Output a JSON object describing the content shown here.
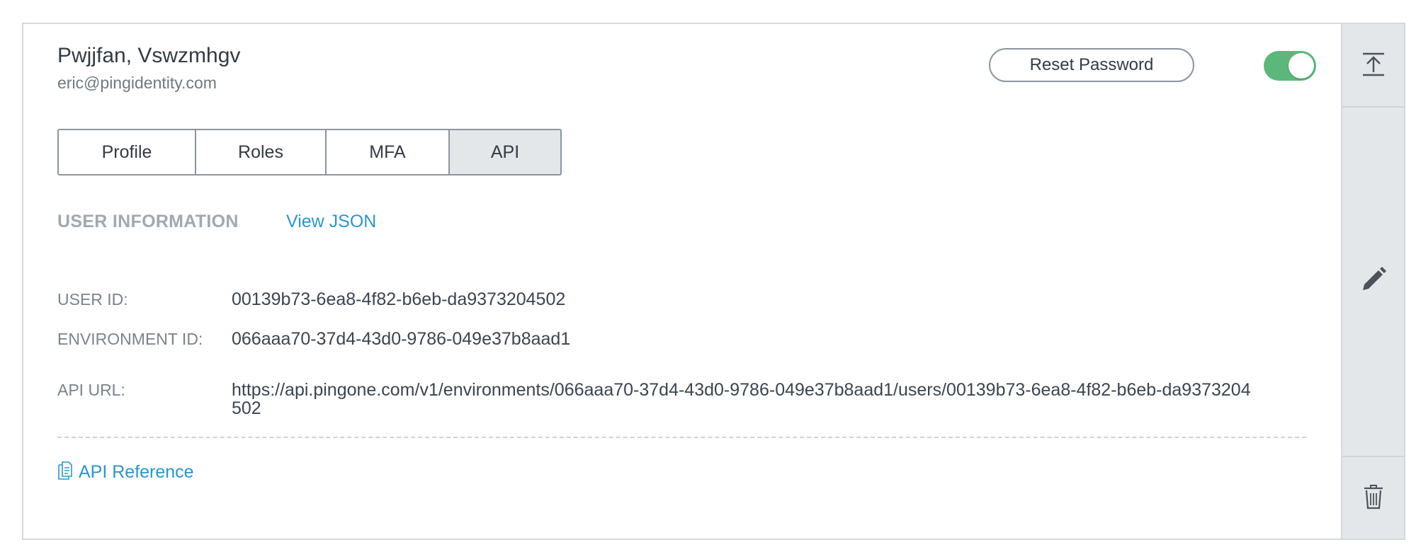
{
  "user": {
    "name": "Pwjjfan, Vswzmhgv",
    "email": "eric@pingidentity.com"
  },
  "actions": {
    "reset_password_label": "Reset Password",
    "toggle_enabled": true
  },
  "tabs": [
    {
      "label": "Profile",
      "active": false
    },
    {
      "label": "Roles",
      "active": false
    },
    {
      "label": "MFA",
      "active": false
    },
    {
      "label": "API",
      "active": true
    }
  ],
  "section": {
    "heading": "USER INFORMATION",
    "view_json_label": "View JSON"
  },
  "fields": [
    {
      "label": "USER ID:",
      "value": "00139b73-6ea8-4f82-b6eb-da9373204502"
    },
    {
      "label": "ENVIRONMENT ID:",
      "value": "066aaa70-37d4-43d0-9786-049e37b8aad1"
    },
    {
      "label": "API URL:",
      "value": "https://api.pingone.com/v1/environments/066aaa70-37d4-43d0-9786-049e37b8aad1/users/00139b73-6ea8-4f82-b6eb-da9373204502"
    }
  ],
  "footer": {
    "api_reference_label": "API Reference"
  },
  "sidebar": {
    "icons": [
      "collapse-icon",
      "pencil-icon",
      "trash-icon"
    ]
  },
  "colors": {
    "accent": "#2a97c9",
    "toggle_on": "#5bb87a",
    "sidebar_bg": "#e4e7ea"
  }
}
